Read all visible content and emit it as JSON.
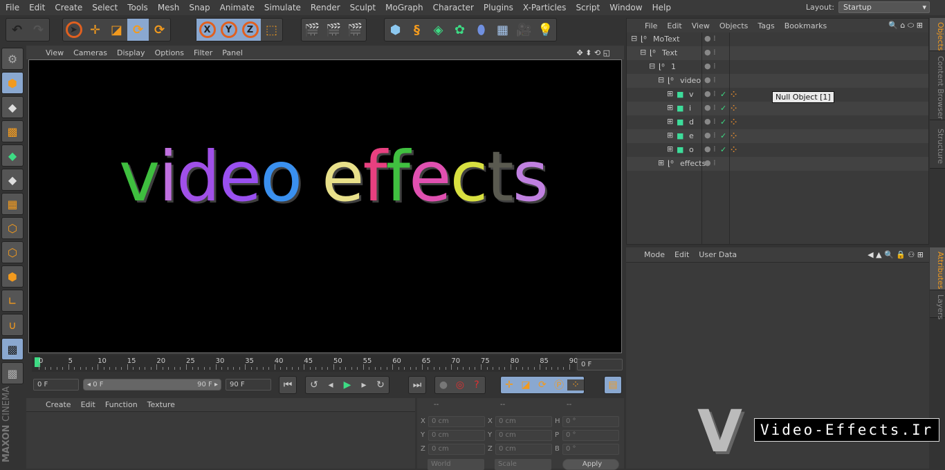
{
  "menu": [
    "File",
    "Edit",
    "Create",
    "Select",
    "Tools",
    "Mesh",
    "Snap",
    "Animate",
    "Simulate",
    "Render",
    "Sculpt",
    "MoGraph",
    "Character",
    "Plugins",
    "X-Particles",
    "Script",
    "Window",
    "Help"
  ],
  "layout": {
    "label": "Layout:",
    "value": "Startup"
  },
  "viewport": {
    "menu": [
      "View",
      "Cameras",
      "Display",
      "Options",
      "Filter",
      "Panel"
    ],
    "scene_text": [
      {
        "ch": "v",
        "color": "#3fbf3f"
      },
      {
        "ch": "i",
        "color": "#c070e0"
      },
      {
        "ch": "d",
        "color": "#a050e8"
      },
      {
        "ch": "e",
        "color": "#9a50f0"
      },
      {
        "ch": "o",
        "color": "#3a90ef"
      },
      {
        "ch": " ",
        "color": "#000"
      },
      {
        "ch": "e",
        "color": "#e8e08a"
      },
      {
        "ch": "f",
        "color": "#e84080"
      },
      {
        "ch": "f",
        "color": "#40c040"
      },
      {
        "ch": "e",
        "color": "#e050b0"
      },
      {
        "ch": "c",
        "color": "#d8e040"
      },
      {
        "ch": "t",
        "color": "#5a5a50"
      },
      {
        "ch": "s",
        "color": "#c080e0"
      }
    ]
  },
  "timeline": {
    "ticks": [
      "0",
      "5",
      "10",
      "15",
      "20",
      "25",
      "30",
      "35",
      "40",
      "45",
      "50",
      "55",
      "60",
      "65",
      "70",
      "75",
      "80",
      "85",
      "90"
    ],
    "current": "0 F",
    "start": "0 F",
    "range_start": "0 F",
    "range_end": "90 F",
    "end": "90 F"
  },
  "material": {
    "menu": [
      "Create",
      "Edit",
      "Function",
      "Texture"
    ]
  },
  "coordinates": {
    "headers": [
      "--",
      "--",
      "--"
    ],
    "rows": [
      {
        "a": "X",
        "av": "0 cm",
        "b": "X",
        "bv": "0 cm",
        "c": "H",
        "cv": "0 °"
      },
      {
        "a": "Y",
        "av": "0 cm",
        "b": "Y",
        "bv": "0 cm",
        "c": "P",
        "cv": "0 °"
      },
      {
        "a": "Z",
        "av": "0 cm",
        "b": "Z",
        "bv": "0 cm",
        "c": "B",
        "cv": "0 °"
      }
    ],
    "mode": "World",
    "scale": "Scale",
    "apply": "Apply"
  },
  "objects": {
    "menu": [
      "File",
      "Edit",
      "View",
      "Objects",
      "Tags",
      "Bookmarks"
    ],
    "items": [
      {
        "name": "MoText",
        "depth": 0,
        "type": "null",
        "exp": "−"
      },
      {
        "name": "Text",
        "depth": 1,
        "type": "null",
        "exp": "−"
      },
      {
        "name": "1",
        "depth": 2,
        "type": "null",
        "exp": "−"
      },
      {
        "name": "video",
        "depth": 3,
        "type": "null",
        "exp": "−"
      },
      {
        "name": "v",
        "depth": 4,
        "type": "extrude",
        "exp": "+"
      },
      {
        "name": "i",
        "depth": 4,
        "type": "extrude",
        "exp": "+"
      },
      {
        "name": "d",
        "depth": 4,
        "type": "extrude",
        "exp": "+"
      },
      {
        "name": "e",
        "depth": 4,
        "type": "extrude",
        "exp": "+"
      },
      {
        "name": "o",
        "depth": 4,
        "type": "extrude",
        "exp": "+"
      },
      {
        "name": "effects",
        "depth": 3,
        "type": "null",
        "exp": "+"
      }
    ],
    "tooltip": "Null Object [1]"
  },
  "side_tabs_top": [
    "Objects",
    "Content Browser",
    "Structure"
  ],
  "side_tabs_bottom": [
    "Attributes",
    "Layers"
  ],
  "attributes": {
    "menu": [
      "Mode",
      "Edit",
      "User Data"
    ]
  },
  "branding": {
    "maxon": "MAXON",
    "cinema": "CINEMA"
  },
  "watermark": "Video-Effects.Ir",
  "colors": {
    "accent": "#f29a1e",
    "active": "#8aa8d0",
    "play": "#3ddc84"
  }
}
